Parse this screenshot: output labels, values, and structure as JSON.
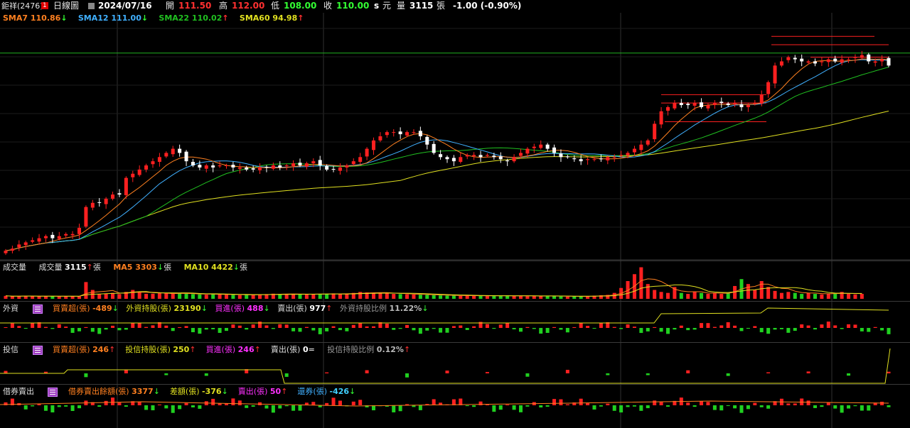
{
  "header": {
    "stock": "鉅祥(2476)",
    "badge": "1",
    "chart_kind": "日線圖",
    "date": "2024/07/16",
    "open_label": "開",
    "open": "111.50",
    "high_label": "高",
    "high": "112.00",
    "low_label": "低",
    "low": "108.00",
    "close_label": "收",
    "close": "110.00",
    "s_label": "s",
    "unit": "元",
    "vol_label": "量",
    "volume": "3115",
    "vol_unit": "張",
    "change": "-1.00 (-0.90%)"
  },
  "price_legend": {
    "sma7": "SMA7 110.86",
    "sma7_arrow": "↓",
    "sma12": "SMA12 111.00",
    "sma12_arrow": "↓",
    "sma22": "SMA22 110.02",
    "sma22_arrow": "↑",
    "sma60": "SMA60 94.98",
    "sma60_arrow": "↑"
  },
  "volume_legend": {
    "title": "成交量",
    "vol_name": "成交量",
    "vol_value": "3115",
    "vol_arrow": "↑",
    "vol_unit": "張",
    "ma5": "MA5 3303",
    "ma5_arrow": "↓",
    "ma5_unit": "張",
    "ma10": "MA10 4422",
    "ma10_arrow": "↓",
    "ma10_unit": "張"
  },
  "foreign_legend": {
    "title": "外資",
    "net": "買賣超(張)",
    "net_value": "-489",
    "net_arrow": "↓",
    "hold": "外資持股(張)",
    "hold_value": "23190",
    "hold_arrow": "↓",
    "buy": "買進(張)",
    "buy_value": "488",
    "buy_arrow": "↓",
    "sell": "賣出(張)",
    "sell_value": "977",
    "sell_arrow": "↑",
    "ratio": "外資持股比例",
    "ratio_value": "11.22%",
    "ratio_arrow": "↓"
  },
  "trust_legend": {
    "title": "投信",
    "net": "買賣超(張)",
    "net_value": "246",
    "net_arrow": "↑",
    "hold": "投信持股(張)",
    "hold_value": "250",
    "hold_arrow": "↑",
    "buy": "買進(張)",
    "buy_value": "246",
    "buy_arrow": "↑",
    "sell": "賣出(張)",
    "sell_value": "0",
    "sell_arrow": "=",
    "ratio": "投信持股比例",
    "ratio_value": "0.12%",
    "ratio_arrow": "↑"
  },
  "sbl_legend": {
    "title": "借券賣出",
    "bal": "借券賣出餘額(張)",
    "bal_value": "3377",
    "bal_arrow": "↓",
    "diff": "差額(張)",
    "diff_value": "-376",
    "diff_arrow": "↓",
    "sell": "賣出(張)",
    "sell_value": "50",
    "sell_arrow": "↑",
    "ret": "還券(張)",
    "ret_value": "-426",
    "ret_arrow": "↓"
  },
  "colors": {
    "up": "#ff2020",
    "down": "#ffffff",
    "down_bar": "#20d020",
    "sma7": "#ff8020",
    "sma12": "#40b0ff",
    "sma22": "#20c020",
    "sma60": "#e0e020",
    "grid": "#303030",
    "hline": "#20b020"
  },
  "chart_data": {
    "type": "candlestick",
    "price_reference_line": 114,
    "price_range": [
      65,
      123
    ],
    "last_values": {
      "open": 111.5,
      "high": 112.0,
      "low": 108.0,
      "close": 110.0,
      "volume": 3115
    },
    "close_path": [
      66.5,
      67,
      68,
      68.5,
      69,
      69.5,
      70,
      69.5,
      70,
      70.5,
      70.5,
      72,
      77,
      78,
      78,
      79,
      80,
      80,
      84,
      85,
      86,
      87,
      88,
      89,
      90,
      91,
      90,
      88,
      87,
      86.5,
      87,
      86.5,
      87,
      87,
      86.5,
      86.5,
      86,
      86,
      86.5,
      86.5,
      87,
      86.5,
      87,
      87.5,
      87,
      87.5,
      88,
      87,
      86,
      86,
      86.5,
      87,
      88,
      89,
      91,
      93,
      94,
      95,
      95,
      94.5,
      95,
      95,
      94,
      92,
      90,
      89,
      88.5,
      88,
      89,
      89.5,
      89.5,
      89,
      89.5,
      89,
      88.5,
      88,
      89,
      90,
      91,
      91.5,
      92,
      91,
      90,
      89,
      89,
      88.5,
      88,
      88.5,
      88.5,
      88.5,
      89,
      89,
      89.5,
      90,
      91,
      92,
      93,
      97,
      100,
      101,
      102,
      101.5,
      101.5,
      102,
      101,
      101.5,
      102,
      102,
      101.5,
      102,
      101,
      101.5,
      102,
      104,
      107,
      111,
      112,
      113,
      112.5,
      112,
      112,
      111.5,
      112,
      112.5,
      112,
      112.5,
      112.5,
      113,
      113.5,
      112,
      112,
      112.5,
      111
    ],
    "volume_profile": [
      300,
      250,
      280,
      300,
      270,
      250,
      260,
      280,
      240,
      260,
      250,
      240,
      1700,
      900,
      500,
      520,
      600,
      480,
      700,
      900,
      700,
      500,
      520,
      560,
      600,
      500,
      550,
      520,
      480,
      450,
      420,
      500,
      450,
      420,
      400,
      380,
      420,
      400,
      450,
      480,
      520,
      500,
      480,
      500,
      460,
      440,
      480,
      500,
      520,
      550,
      480,
      500,
      600,
      700,
      650,
      600,
      620,
      550,
      500,
      480,
      460,
      440,
      420,
      400,
      380,
      350,
      330,
      320,
      300,
      320,
      340,
      300,
      280,
      300,
      320,
      340,
      300,
      280,
      260,
      280,
      300,
      320,
      260,
      240,
      220,
      240,
      260,
      280,
      320,
      360,
      400,
      600,
      1100,
      1800,
      2500,
      3200,
      1500,
      900,
      700,
      600,
      1200,
      600,
      500,
      700,
      600,
      500,
      600,
      500,
      600,
      1300,
      2000,
      1500,
      900,
      1800,
      1200,
      800,
      600,
      700,
      600,
      500,
      600,
      500,
      450,
      500,
      600,
      700,
      500,
      450,
      500
    ]
  }
}
